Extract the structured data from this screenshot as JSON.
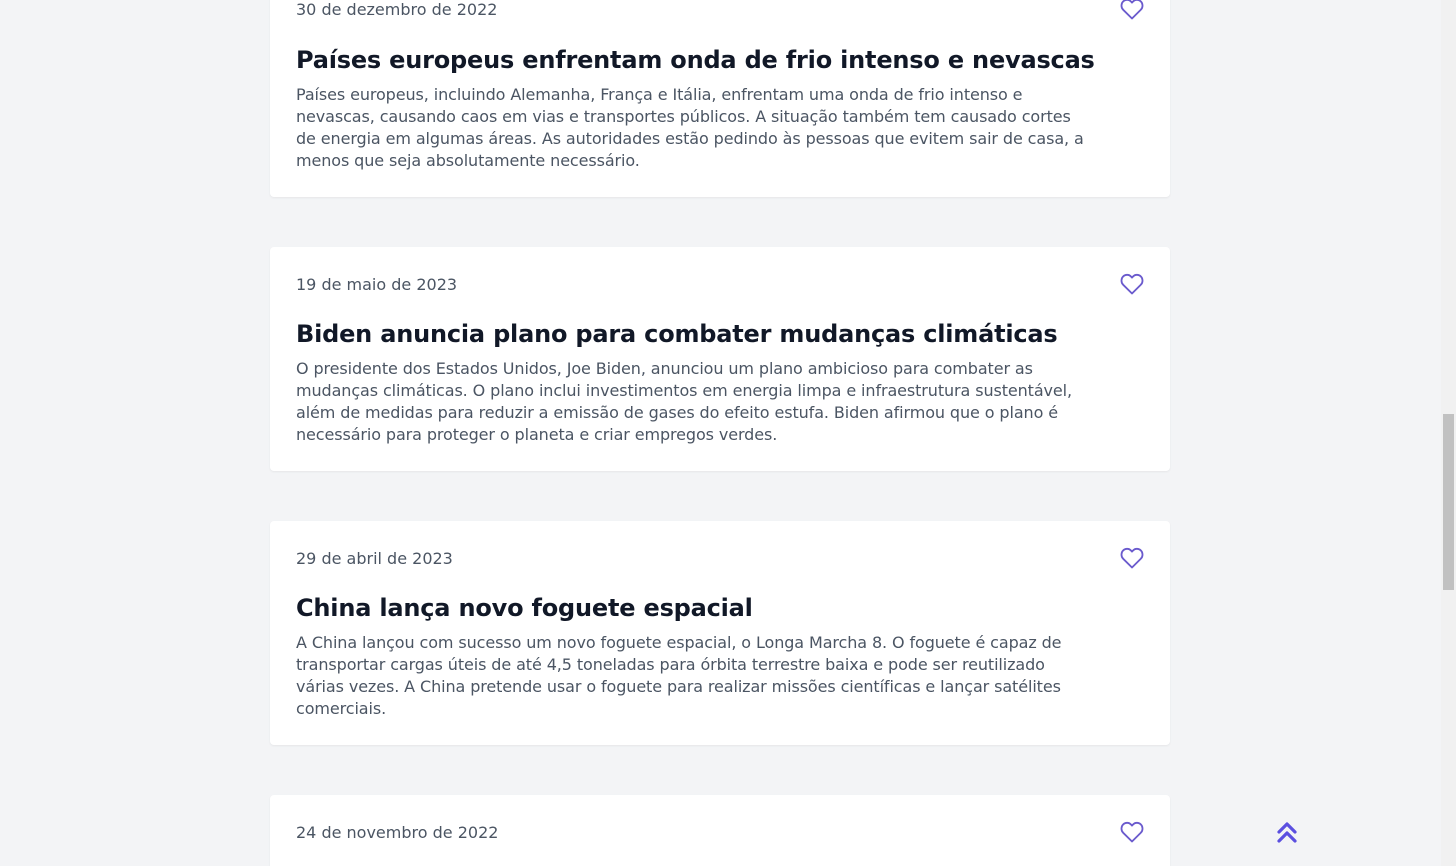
{
  "colors": {
    "accent": "#6a5acd",
    "background": "#f3f4f6",
    "card": "#ffffff",
    "title": "#111827",
    "text": "#4b5563"
  },
  "articles": [
    {
      "date": "30 de dezembro de 2022",
      "title": "Países europeus enfrentam onda de frio intenso e nevascas",
      "lines": [
        "Países europeus, incluindo Alemanha, França e Itália, enfrentam uma onda de frio intenso e",
        "nevascas, causando caos em vias e transportes públicos. A situação também tem causado cortes",
        "de energia em algumas áreas. As autoridades estão pedindo às pessoas que evitem sair de casa, a",
        "menos que seja absolutamente necessário."
      ],
      "favorite_icon": "heart-outline-icon"
    },
    {
      "date": "19 de maio de 2023",
      "title": "Biden anuncia plano para combater mudanças climáticas",
      "lines": [
        "O presidente dos Estados Unidos, Joe Biden, anunciou um plano ambicioso para combater as",
        "mudanças climáticas. O plano inclui investimentos em energia limpa e infraestrutura sustentável,",
        "além de medidas para reduzir a emissão de gases do efeito estufa. Biden afirmou que o plano é",
        "necessário para proteger o planeta e criar empregos verdes."
      ],
      "favorite_icon": "heart-outline-icon"
    },
    {
      "date": "29 de abril de 2023",
      "title": "China lança novo foguete espacial",
      "lines": [
        "A China lançou com sucesso um novo foguete espacial, o Longa Marcha 8. O foguete é capaz de",
        "transportar cargas úteis de até 4,5 toneladas para órbita terrestre baixa e pode ser reutilizado",
        "várias vezes. A China pretende usar o foguete para realizar missões científicas e lançar satélites",
        "comerciais."
      ],
      "favorite_icon": "heart-outline-icon"
    },
    {
      "date": "24 de novembro de 2022",
      "favorite_icon": "heart-outline-icon"
    }
  ],
  "back_to_top_icon": "double-chevron-up-icon"
}
